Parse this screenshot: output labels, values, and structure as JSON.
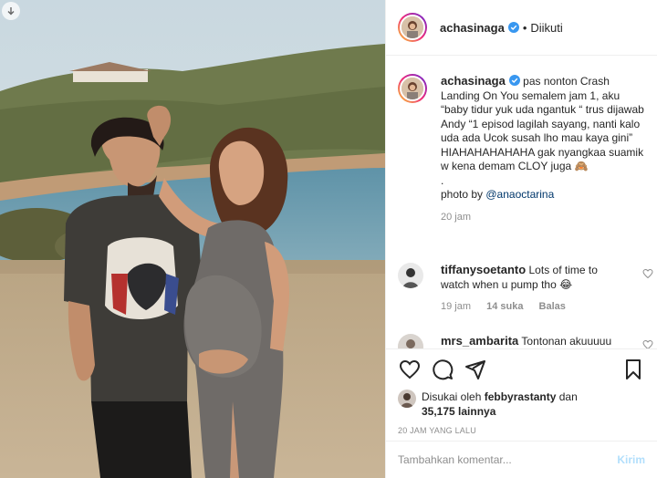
{
  "post": {
    "username": "achasinaga",
    "verified": true,
    "separator": "•",
    "follow_state": "Diikuti"
  },
  "caption": {
    "username": "achasinaga",
    "text": " pas nonton Crash Landing On You semalem jam 1, aku “baby tidur yuk uda ngantuk “ trus dijawab Andy “1 episod lagilah sayang, nanti kalo uda ada Ucok susah lho mau kaya gini” HIAHAHAHAHAHA gak nyangkaa suamik w kena demam CLOY juga 🙈\n.\nphoto by ",
    "mention": "@anaoctarina",
    "time": "20 jam"
  },
  "comments": [
    {
      "username": "tiffanysoetanto",
      "text": " Lots of time to watch when u pump tho 😂",
      "time": "19 jam",
      "likes": "14 suka",
      "reply_label": "Balas"
    },
    {
      "username": "mrs_ambarita",
      "text": " Tontonan akuuuuu"
    }
  ],
  "likes": {
    "prefix": "Disukai oleh ",
    "first_user": "febbyrastanty",
    "connector": " dan",
    "count": "35,175 lainnya"
  },
  "time_ago": "20 JAM YANG LALU",
  "comment_input": {
    "placeholder": "Tambahkan komentar...",
    "post_label": "Kirim"
  },
  "icons": {
    "download": "arrow-down-icon",
    "verified": "verified-badge-icon",
    "like": "heart-icon",
    "comment": "comment-bubble-icon",
    "share": "paper-plane-icon",
    "save": "bookmark-icon",
    "comment_like": "heart-outline-icon"
  },
  "colors": {
    "verified": "#3897f0",
    "mention": "#00376b",
    "muted": "#8e8e8e",
    "post_button_disabled": "#b2dffc"
  }
}
